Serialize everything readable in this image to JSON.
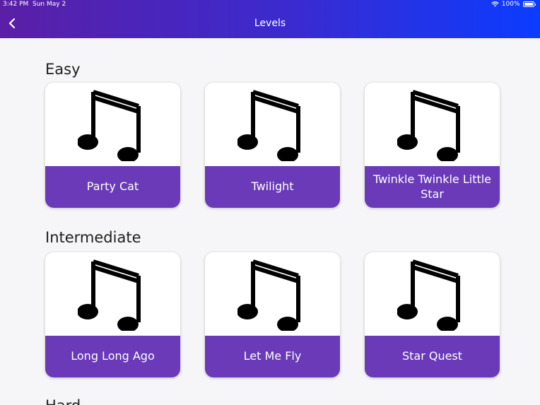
{
  "status_bar": {
    "time": "3:42 PM",
    "date": "Sun May 2",
    "battery": "100%"
  },
  "header": {
    "title": "Levels"
  },
  "sections": [
    {
      "title": "Easy",
      "levels": [
        {
          "label": "Party Cat"
        },
        {
          "label": "Twilight"
        },
        {
          "label": "Twinkle Twinkle Little Star"
        }
      ]
    },
    {
      "title": "Intermediate",
      "levels": [
        {
          "label": "Long Long Ago"
        },
        {
          "label": "Let Me Fly"
        },
        {
          "label": "Star Quest"
        }
      ]
    },
    {
      "title": "Hard"
    }
  ],
  "icons": {
    "back": "chevron-left-icon",
    "level": "music-note-icon",
    "wifi": "wifi-icon",
    "battery": "battery-icon"
  },
  "colors": {
    "header_start": "#5a1fa6",
    "header_end": "#0b3cff",
    "card_label_bg": "#6a3ab8",
    "background": "#f6f6f8"
  }
}
